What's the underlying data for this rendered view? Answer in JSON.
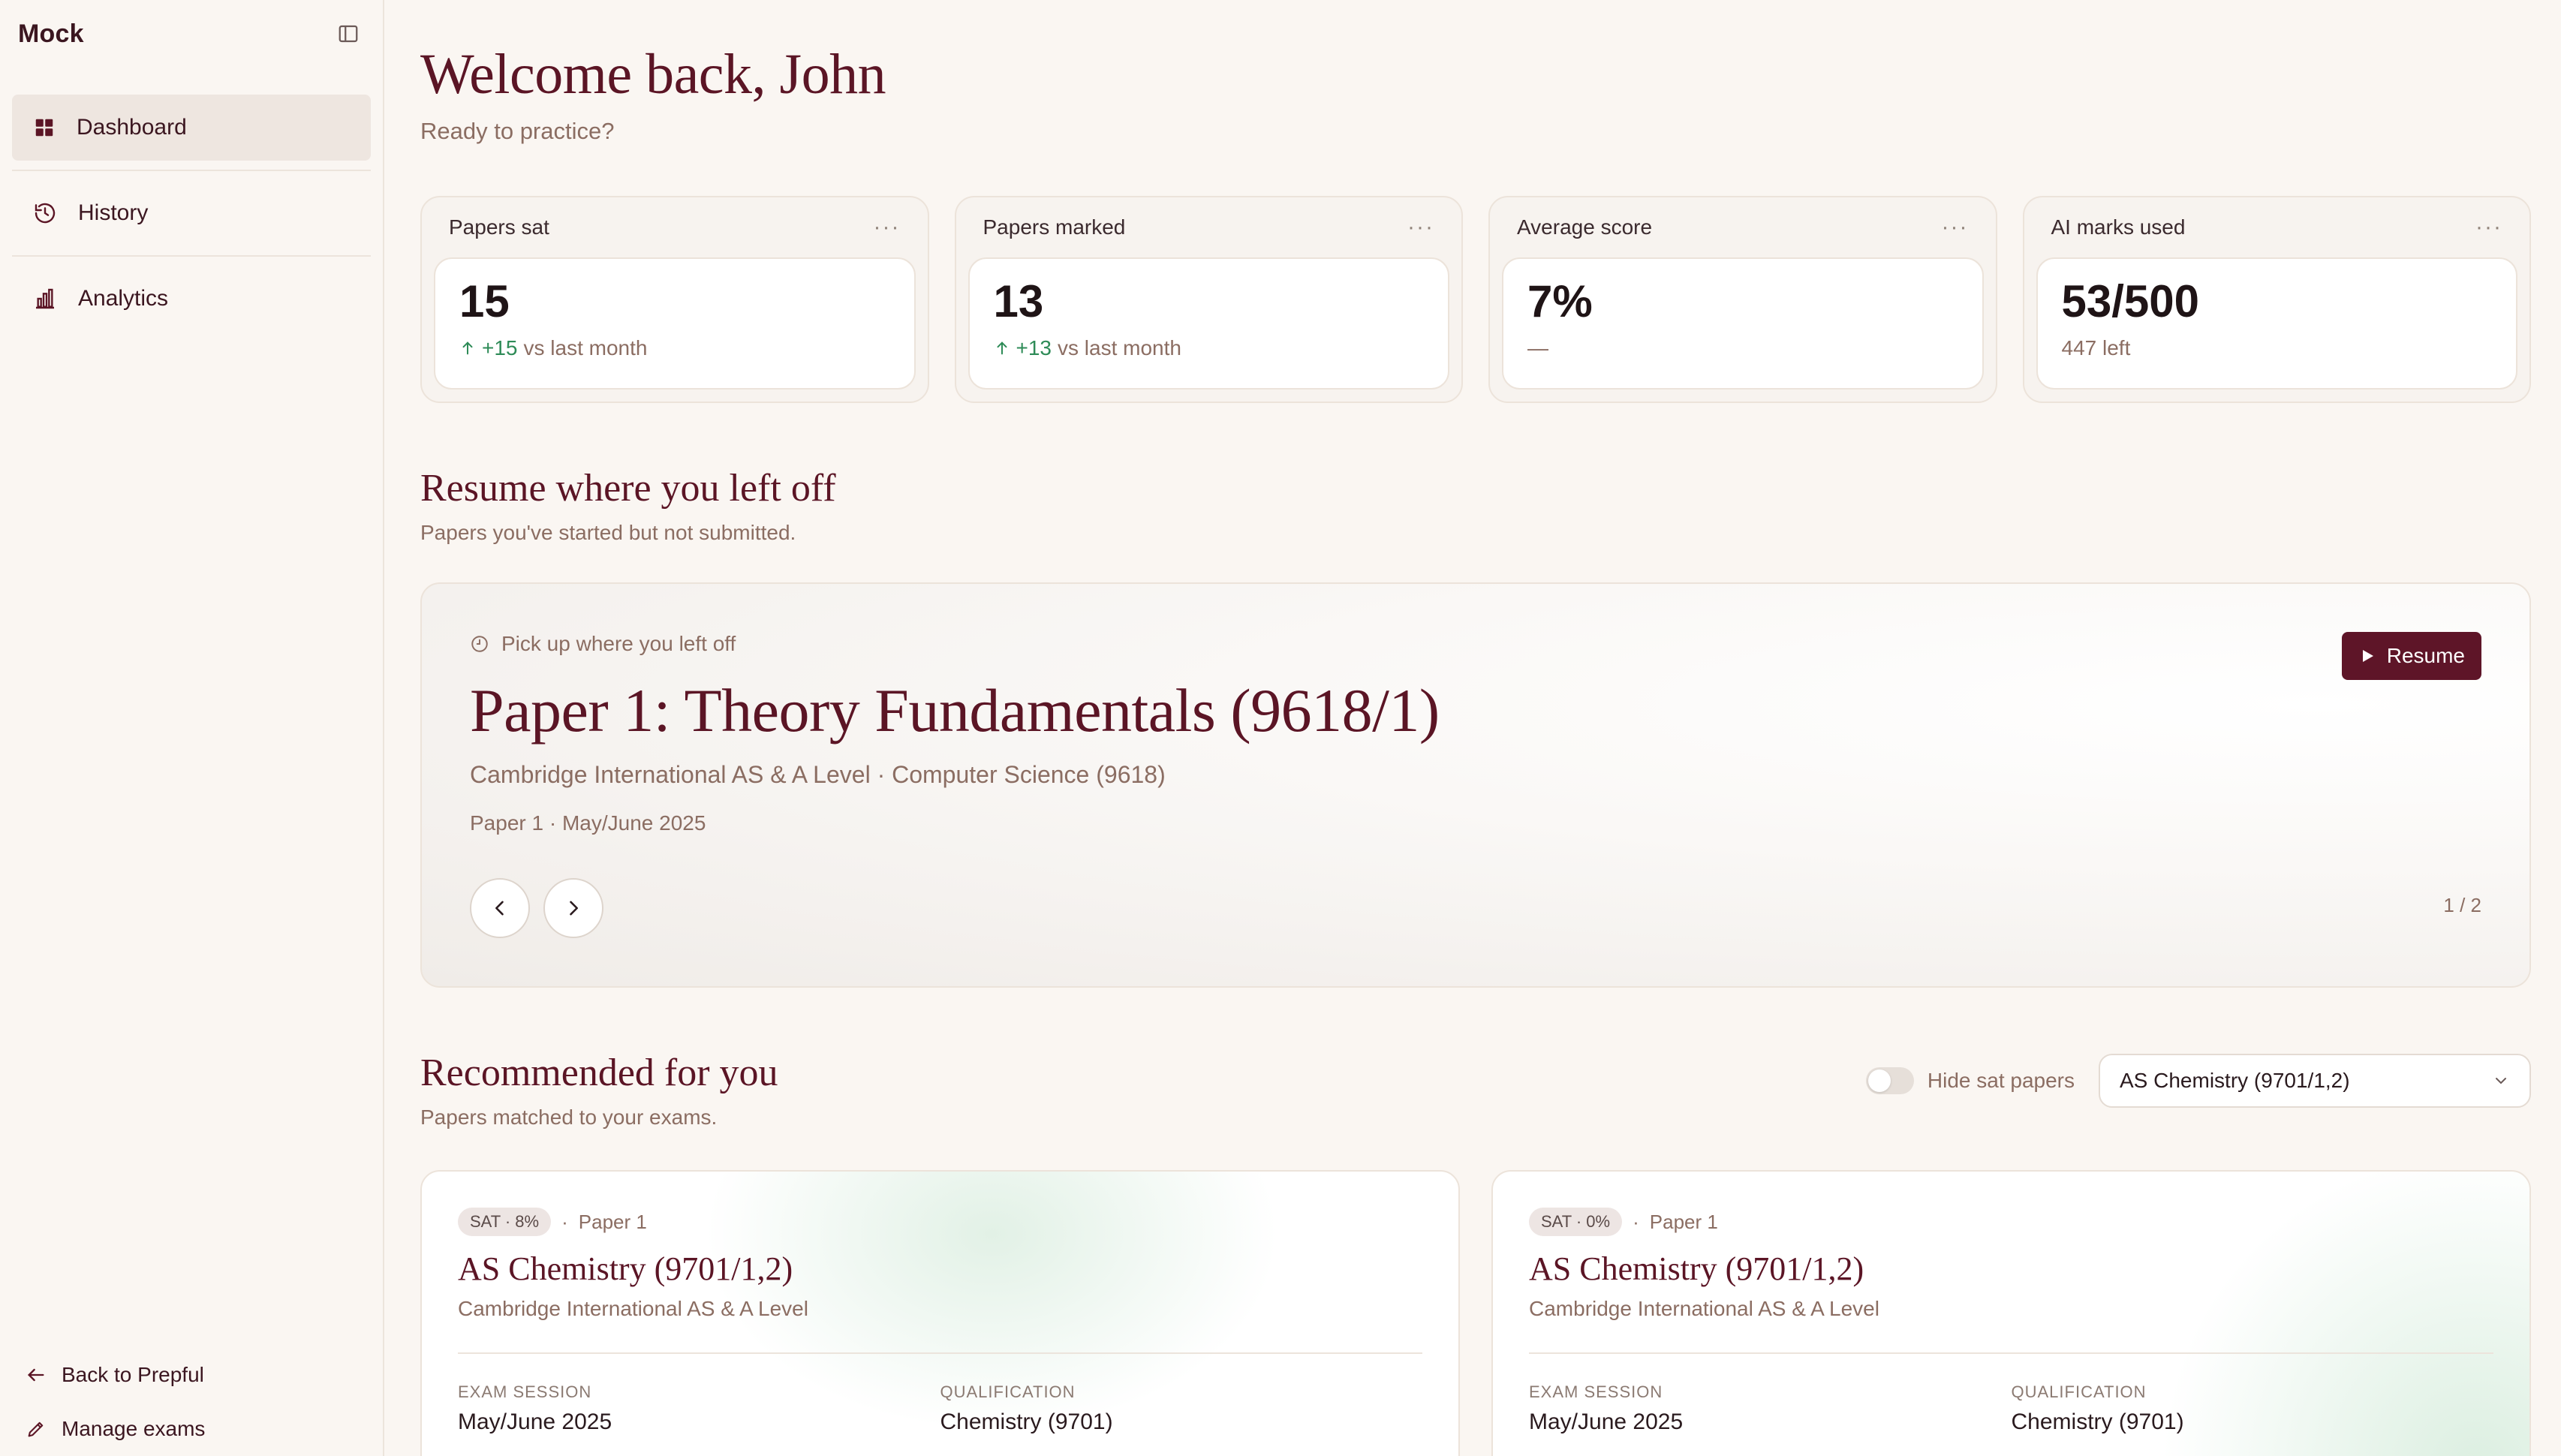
{
  "sidebar": {
    "brand": "Mock",
    "nav": [
      {
        "label": "Dashboard",
        "icon": "grid-icon",
        "active": true
      },
      {
        "label": "History",
        "icon": "history-icon"
      },
      {
        "label": "Analytics",
        "icon": "bar-chart-icon"
      }
    ],
    "footer": [
      {
        "label": "Back to Prepful",
        "icon": "arrow-left-icon"
      },
      {
        "label": "Manage exams",
        "icon": "pencil-icon"
      }
    ]
  },
  "header": {
    "welcome": "Welcome back, John",
    "subtitle": "Ready to practice?"
  },
  "stats": [
    {
      "label": "Papers sat",
      "value": "15",
      "delta": "+15",
      "note": "vs last month"
    },
    {
      "label": "Papers marked",
      "value": "13",
      "delta": "+13",
      "note": "vs last month"
    },
    {
      "label": "Average score",
      "value": "7%",
      "note": "—"
    },
    {
      "label": "AI marks used",
      "value": "53/500",
      "note": "447 left"
    }
  ],
  "resume": {
    "title": "Resume where you left off",
    "subtitle": "Papers you've started but not submitted.",
    "card": {
      "pickup": "Pick up where you left off",
      "paper_title": "Paper 1: Theory Fundamentals (9618/1)",
      "board": "Cambridge International AS & A Level · Computer Science (9618)",
      "meta": "Paper 1 · May/June 2025",
      "resume_label": "Resume",
      "pager": "1 / 2"
    }
  },
  "recommended": {
    "title": "Recommended for you",
    "subtitle": "Papers matched to your exams.",
    "toggle_label": "Hide sat papers",
    "select_value": "AS Chemistry (9701/1,2)",
    "cards": [
      {
        "badge": "SAT · 8%",
        "paper": "Paper 1",
        "title": "AS Chemistry (9701/1,2)",
        "board": "Cambridge International AS & A Level",
        "session_label": "EXAM SESSION",
        "session": "May/June 2025",
        "qual_label": "QUALIFICATION",
        "qual": "Chemistry (9701)"
      },
      {
        "badge": "SAT · 0%",
        "paper": "Paper 1",
        "title": "AS Chemistry (9701/1,2)",
        "board": "Cambridge International AS & A Level",
        "session_label": "EXAM SESSION",
        "session": "May/June 2025",
        "qual_label": "QUALIFICATION",
        "qual": "Chemistry (9701)"
      }
    ]
  },
  "colors": {
    "accent": "#5e1528",
    "positive": "#2e8b57",
    "background": "#faf6f2"
  }
}
